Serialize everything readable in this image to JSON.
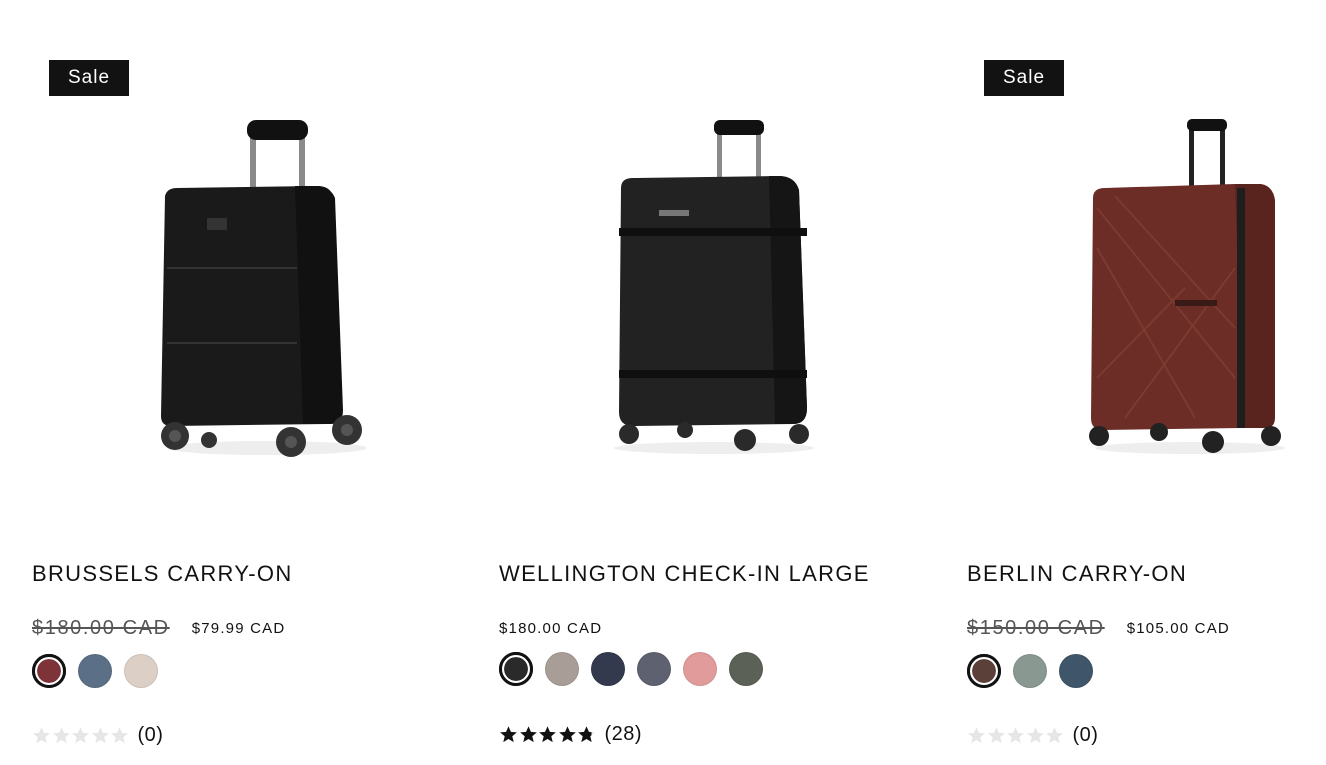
{
  "products": [
    {
      "badge": "Sale",
      "title": "BRUSSELS CARRY-ON",
      "price_old": "$180.00 CAD",
      "price_now": "$79.99 CAD",
      "swatches": [
        {
          "color": "#7d3337",
          "selected": true
        },
        {
          "color": "#5b6f86",
          "selected": false
        },
        {
          "color": "#dccfc5",
          "selected": false
        }
      ],
      "rating": 0,
      "reviews": "(0)",
      "image": {
        "icon": "carry-on-suitcase-image",
        "body_color": "#1a1a1a"
      }
    },
    {
      "badge": "",
      "title": "WELLINGTON CHECK-IN LARGE",
      "price_old": "",
      "price_now": "$180.00 CAD",
      "swatches": [
        {
          "color": "#2a2a2a",
          "selected": true
        },
        {
          "color": "#a89e97",
          "selected": false
        },
        {
          "color": "#333a4e",
          "selected": false
        },
        {
          "color": "#5e6170",
          "selected": false
        },
        {
          "color": "#e19b9b",
          "selected": false
        },
        {
          "color": "#5b6156",
          "selected": false
        }
      ],
      "rating": 4.8,
      "reviews": "(28)",
      "image": {
        "icon": "large-suitcase-image",
        "body_color": "#1e1e1e"
      }
    },
    {
      "badge": "Sale",
      "title": "BERLIN CARRY-ON",
      "price_old": "$150.00 CAD",
      "price_now": "$105.00 CAD",
      "swatches": [
        {
          "color": "#5a4038",
          "selected": true
        },
        {
          "color": "#899891",
          "selected": false
        },
        {
          "color": "#3f5569",
          "selected": false
        }
      ],
      "rating": 0,
      "reviews": "(0)",
      "image": {
        "icon": "maroon-suitcase-image",
        "body_color": "#6b2d25"
      }
    }
  ],
  "colors": {
    "badge_bg": "#121212",
    "star_filled": "#121212",
    "star_empty": "#e6e6e6"
  }
}
